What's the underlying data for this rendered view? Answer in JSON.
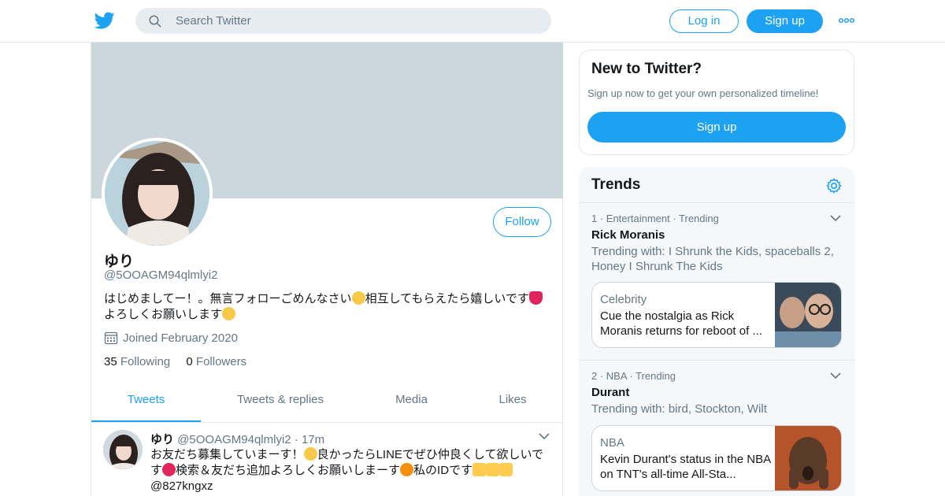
{
  "topbar": {
    "logo_icon": "twitter-bird-icon",
    "search_placeholder": "Search Twitter",
    "login_label": "Log in",
    "signup_label": "Sign up",
    "more_icon": "more-dots-icon"
  },
  "profile": {
    "follow_label": "Follow",
    "name": "ゆり",
    "handle": "@5OOAGM94qlmlyi2",
    "bio_line1": "はじめましてー！。無言フォローごめんなさい",
    "bio_line1b": "相互してもらえたら嬉しいです",
    "bio_line2": "よろしくお願いします",
    "joined": "Joined February 2020",
    "following_count": "35",
    "following_label": "Following",
    "followers_count": "0",
    "followers_label": "Followers",
    "tabs": [
      {
        "label": "Tweets"
      },
      {
        "label": "Tweets & replies"
      },
      {
        "label": "Media"
      },
      {
        "label": "Likes"
      }
    ]
  },
  "tweet": {
    "name": "ゆり",
    "handle": "@5OOAGM94qlmlyi2",
    "dot": "·",
    "time": "17m",
    "text1": "お友だち募集していまーす！",
    "text1b": "良かったらLINEでぜひ仲良くして欲しいで",
    "text2a": "す",
    "text2b": "検索＆友だち追加よろしくお願いしまーす",
    "text2c": "私のIDです",
    "text3": "@827kngxz"
  },
  "signup_card": {
    "title": "New to Twitter?",
    "subtitle": "Sign up now to get your own personalized timeline!",
    "button": "Sign up"
  },
  "trends": {
    "title": "Trends",
    "items": [
      {
        "meta": "1 · Entertainment · Trending",
        "name": "Rick Moranis",
        "with": "Trending with: I Shrunk the Kids, spaceballs 2, Honey I Shrunk The Kids",
        "card_category": "Celebrity",
        "card_headline": "Cue the nostalgia as Rick Moranis returns for reboot of ..."
      },
      {
        "meta": "2 · NBA · Trending",
        "name": "Durant",
        "with": "Trending with: bird, Stockton, Wilt",
        "card_category": "NBA",
        "card_headline": "Kevin Durant's status in the NBA on TNT's all-time All-Sta..."
      }
    ]
  },
  "colors": {
    "accent": "#1da1f2",
    "banner": "#ccd6dd",
    "muted_text": "#657786",
    "border": "#e1e8ed"
  }
}
